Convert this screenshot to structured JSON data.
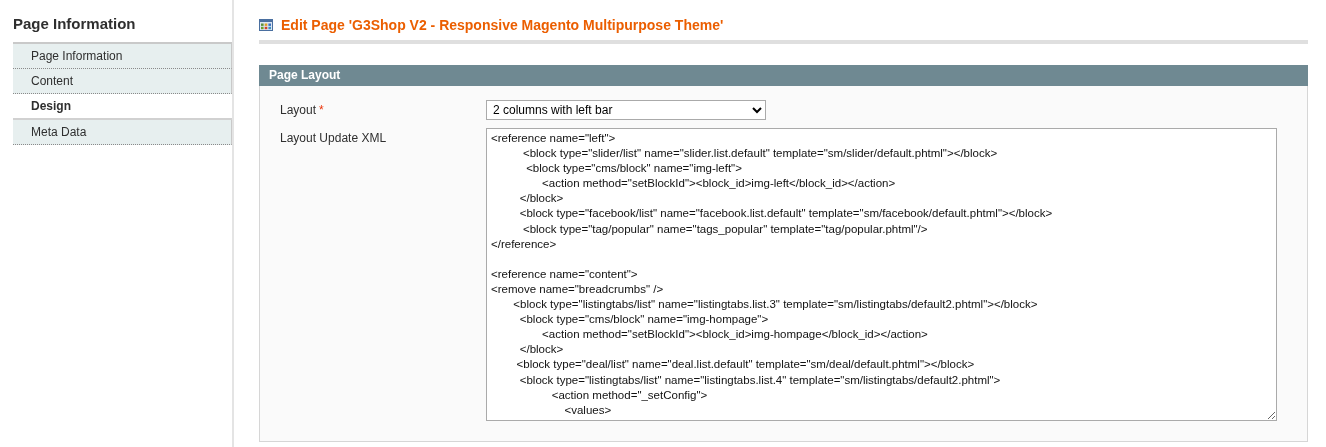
{
  "sidebar": {
    "title": "Page Information",
    "tabs": [
      {
        "label": "Page Information",
        "selected": false
      },
      {
        "label": "Content",
        "selected": false
      },
      {
        "label": "Design",
        "selected": true
      },
      {
        "label": "Meta Data",
        "selected": false
      }
    ]
  },
  "page_title": "Edit Page 'G3Shop V2 - Responsive Magento Multipurpose Theme'",
  "section": {
    "title": "Page Layout",
    "fields": [
      {
        "kind": "select",
        "label": "Layout",
        "required_mark": "*",
        "value": "2 columns with left bar"
      },
      {
        "kind": "textarea",
        "label": "Layout Update XML",
        "value": "<reference name=\"left\">\n          <block type=\"slider/list\" name=\"slider.list.default\" template=\"sm/slider/default.phtml\"></block>\n           <block type=\"cms/block\" name=\"img-left\">\n                <action method=\"setBlockId\"><block_id>img-left</block_id></action>\n         </block>\n         <block type=\"facebook/list\" name=\"facebook.list.default\" template=\"sm/facebook/default.phtml\"></block>\n          <block type=\"tag/popular\" name=\"tags_popular\" template=\"tag/popular.phtml\"/>\n</reference>\n\n<reference name=\"content\">\n<remove name=\"breadcrumbs\" />\n       <block type=\"listingtabs/list\" name=\"listingtabs.list.3\" template=\"sm/listingtabs/default2.phtml\"></block>\n         <block type=\"cms/block\" name=\"img-hompage\">\n                <action method=\"setBlockId\"><block_id>img-hompage</block_id></action>\n         </block>\n        <block type=\"deal/list\" name=\"deal.list.default\" template=\"sm/deal/default.phtml\"></block>\n         <block type=\"listingtabs/list\" name=\"listingtabs.list.4\" template=\"sm/listingtabs/default2.phtml\">\n                   <action method=\"_setConfig\">\n                       <values>"
      }
    ]
  }
}
